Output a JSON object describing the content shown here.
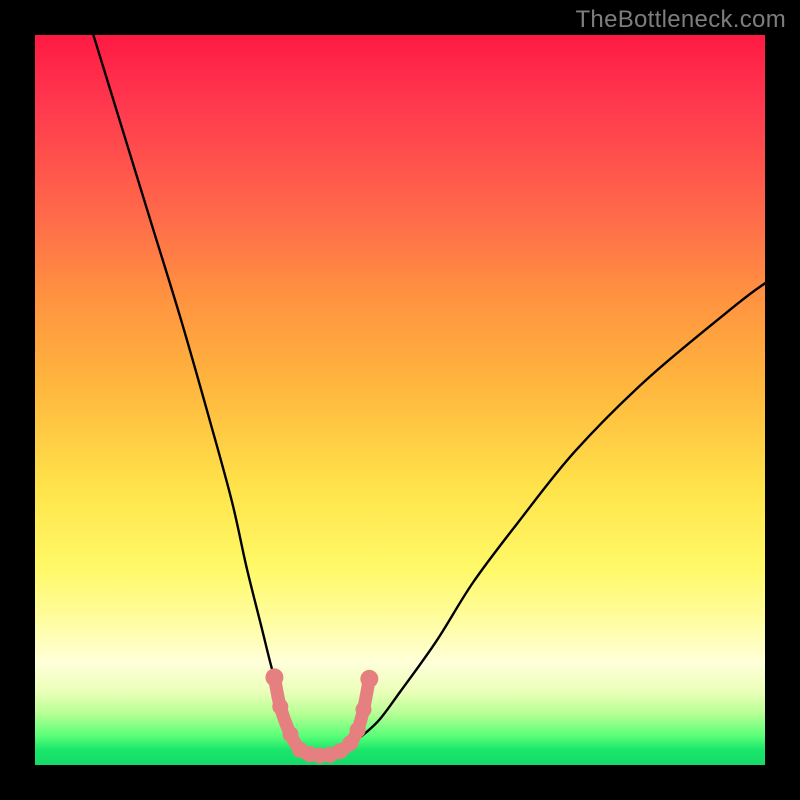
{
  "watermark": "TheBottleneck.com",
  "chart_data": {
    "type": "line",
    "title": "",
    "xlabel": "",
    "ylabel": "",
    "xlim": [
      0,
      100
    ],
    "ylim": [
      0,
      100
    ],
    "grid": false,
    "legend": false,
    "series": [
      {
        "name": "bottleneck-curve",
        "description": "V-shaped black curve with red/salmon marker dots along the basin",
        "x": [
          8,
          12,
          16,
          20,
          24,
          27,
          29,
          31,
          32.5,
          34,
          35.5,
          37,
          38,
          39,
          40,
          42,
          44,
          47,
          50,
          55,
          60,
          66,
          74,
          84,
          96,
          100
        ],
        "y": [
          100,
          87,
          74,
          61,
          47,
          36,
          27,
          19,
          13,
          8,
          4.5,
          2.2,
          1.4,
          1.3,
          1.4,
          2.3,
          3.4,
          6,
          10,
          17,
          25,
          33,
          43,
          53,
          63,
          66
        ]
      }
    ],
    "markers": {
      "name": "basin-markers",
      "color": "#e68080",
      "points": [
        {
          "x": 32.8,
          "y": 12
        },
        {
          "x": 33.6,
          "y": 8
        },
        {
          "x": 35.0,
          "y": 4.2
        },
        {
          "x": 36.3,
          "y": 2.1
        },
        {
          "x": 37.6,
          "y": 1.5
        },
        {
          "x": 39.0,
          "y": 1.3
        },
        {
          "x": 40.4,
          "y": 1.4
        },
        {
          "x": 41.8,
          "y": 1.9
        },
        {
          "x": 43.2,
          "y": 3.0
        },
        {
          "x": 44.2,
          "y": 4.8
        },
        {
          "x": 45.0,
          "y": 7.6
        },
        {
          "x": 45.8,
          "y": 11.8
        }
      ]
    },
    "background_gradient": {
      "direction": "vertical",
      "stops": [
        {
          "pos": 0.0,
          "color": "#ff1a44"
        },
        {
          "pos": 0.25,
          "color": "#ff6b4a"
        },
        {
          "pos": 0.5,
          "color": "#ffc23e"
        },
        {
          "pos": 0.75,
          "color": "#fffd7a"
        },
        {
          "pos": 0.92,
          "color": "#c8ffa0"
        },
        {
          "pos": 1.0,
          "color": "#17d96a"
        }
      ]
    }
  }
}
